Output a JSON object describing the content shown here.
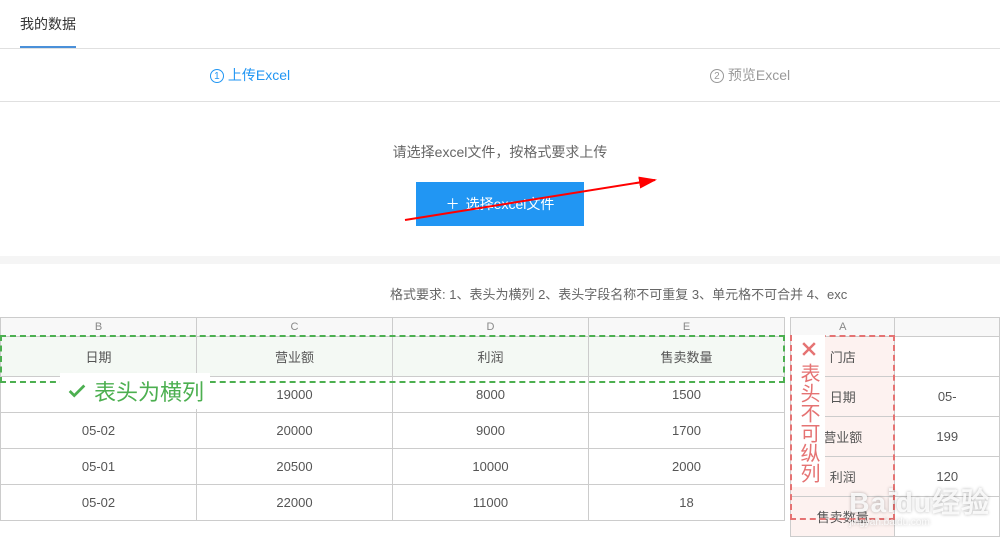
{
  "topTab": "我的数据",
  "steps": {
    "step1": "上传Excel",
    "step2": "预览Excel"
  },
  "upload": {
    "prompt": "请选择excel文件，按格式要求上传",
    "button": "选择excel文件"
  },
  "formatReq": "格式要求:   1、表头为横列   2、表头字段名称不可重复   3、单元格不可合并   4、exc",
  "goodTable": {
    "cols": [
      "B",
      "C",
      "D",
      "E"
    ],
    "headers": [
      "日期",
      "营业额",
      "利润",
      "售卖数量"
    ],
    "rows": [
      [
        "",
        "19000",
        "8000",
        "1500"
      ],
      [
        "05-02",
        "20000",
        "9000",
        "1700"
      ],
      [
        "05-01",
        "20500",
        "10000",
        "2000"
      ],
      [
        "05-02",
        "22000",
        "11000",
        "18"
      ]
    ],
    "label": "表头为横列"
  },
  "badTable": {
    "cols": [
      "A",
      ""
    ],
    "headerCol": [
      "门店",
      "日期",
      "营业额",
      "利润",
      "售卖数量"
    ],
    "dataCol": [
      "",
      "05-",
      "199",
      "120",
      ""
    ],
    "label": "表头不可纵列"
  },
  "watermark": {
    "big": "Bai̇̇du经验",
    "small": "jingyan.baidu.com"
  }
}
